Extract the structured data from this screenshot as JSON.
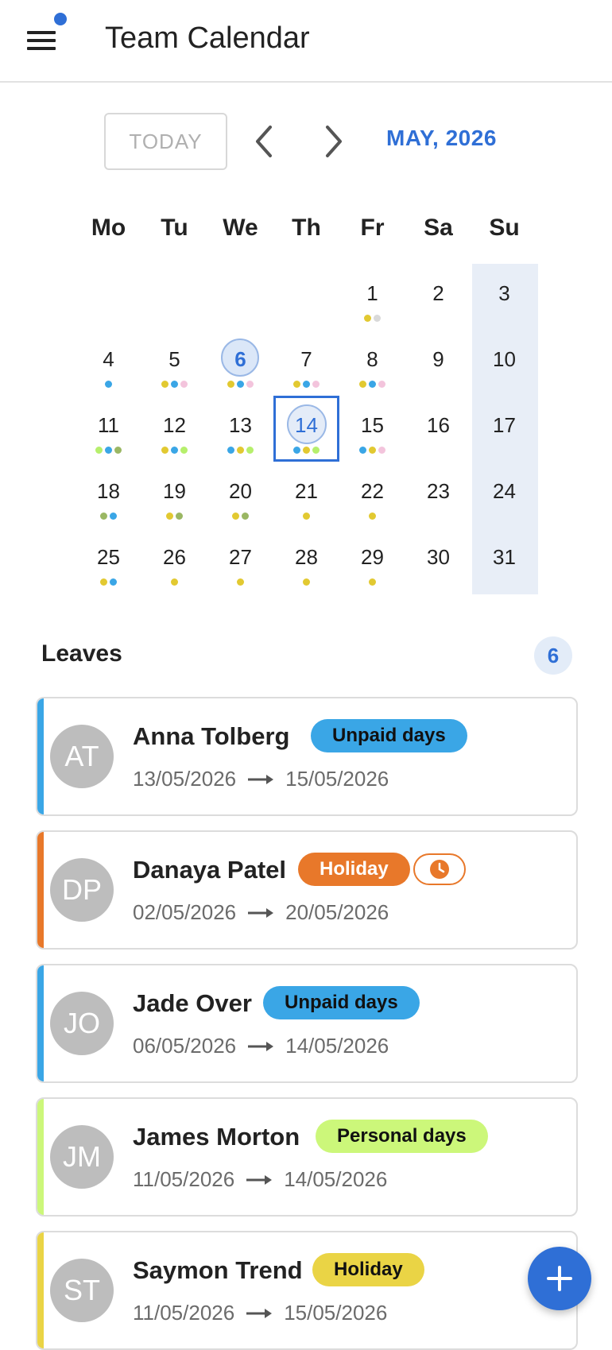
{
  "app": {
    "title": "Team Calendar"
  },
  "toolbar": {
    "today_label": "TODAY",
    "month_label": "MAY, 2026"
  },
  "colors": {
    "accent": "#2f6fd6",
    "unpaid": "#3aa6e6",
    "holiday_orange": "#e8782a",
    "personal": "#ccf77a",
    "holiday_yellow": "#ead445",
    "dot_yellow": "#e2c931",
    "dot_blue": "#3aa6e6",
    "dot_pink": "#f3c4dc",
    "dot_gray": "#d9d9d9",
    "dot_lime": "#b6ef6c",
    "dot_olive": "#9ab763"
  },
  "calendar": {
    "weekdays": [
      "Mo",
      "Tu",
      "We",
      "Th",
      "Fr",
      "Sa",
      "Su"
    ],
    "today": 6,
    "selected": 14,
    "weeks": [
      [
        null,
        null,
        null,
        null,
        {
          "d": "1",
          "dots": [
            "yellow",
            "gray"
          ]
        },
        {
          "d": "2",
          "dots": []
        },
        {
          "d": "3",
          "dots": []
        }
      ],
      [
        {
          "d": "4",
          "dots": [
            "blue"
          ]
        },
        {
          "d": "5",
          "dots": [
            "yellow",
            "blue",
            "pink"
          ]
        },
        {
          "d": "6",
          "dots": [
            "yellow",
            "blue",
            "pink"
          ]
        },
        {
          "d": "7",
          "dots": [
            "yellow",
            "blue",
            "pink"
          ]
        },
        {
          "d": "8",
          "dots": [
            "yellow",
            "blue",
            "pink"
          ]
        },
        {
          "d": "9",
          "dots": []
        },
        {
          "d": "10",
          "dots": []
        }
      ],
      [
        {
          "d": "11",
          "dots": [
            "lime",
            "blue",
            "olive"
          ]
        },
        {
          "d": "12",
          "dots": [
            "yellow",
            "blue",
            "lime"
          ]
        },
        {
          "d": "13",
          "dots": [
            "blue",
            "yellow",
            "lime"
          ]
        },
        {
          "d": "14",
          "dots": [
            "blue",
            "yellow",
            "lime"
          ]
        },
        {
          "d": "15",
          "dots": [
            "blue",
            "yellow",
            "pink"
          ]
        },
        {
          "d": "16",
          "dots": []
        },
        {
          "d": "17",
          "dots": []
        }
      ],
      [
        {
          "d": "18",
          "dots": [
            "olive",
            "blue"
          ]
        },
        {
          "d": "19",
          "dots": [
            "yellow",
            "olive"
          ]
        },
        {
          "d": "20",
          "dots": [
            "yellow",
            "olive"
          ]
        },
        {
          "d": "21",
          "dots": [
            "yellow"
          ]
        },
        {
          "d": "22",
          "dots": [
            "yellow"
          ]
        },
        {
          "d": "23",
          "dots": []
        },
        {
          "d": "24",
          "dots": []
        }
      ],
      [
        {
          "d": "25",
          "dots": [
            "yellow",
            "blue"
          ]
        },
        {
          "d": "26",
          "dots": [
            "yellow"
          ]
        },
        {
          "d": "27",
          "dots": [
            "yellow"
          ]
        },
        {
          "d": "28",
          "dots": [
            "yellow"
          ]
        },
        {
          "d": "29",
          "dots": [
            "yellow"
          ]
        },
        {
          "d": "30",
          "dots": []
        },
        {
          "d": "31",
          "dots": []
        }
      ]
    ]
  },
  "leaves": {
    "title": "Leaves",
    "count": "6",
    "items": [
      {
        "initials": "AT",
        "name": "Anna Tolberg",
        "type": "Unpaid days",
        "color": "#3aa6e6",
        "text_color": "#111111",
        "from": "13/05/2026",
        "to": "15/05/2026",
        "pending": false
      },
      {
        "initials": "DP",
        "name": "Danaya Patel",
        "type": "Holiday",
        "color": "#e8782a",
        "text_color": "#ffffff",
        "from": "02/05/2026",
        "to": "20/05/2026",
        "pending": true
      },
      {
        "initials": "JO",
        "name": "Jade Over",
        "type": "Unpaid days",
        "color": "#3aa6e6",
        "text_color": "#111111",
        "from": "06/05/2026",
        "to": "14/05/2026",
        "pending": false
      },
      {
        "initials": "JM",
        "name": "James Morton",
        "type": "Personal days",
        "color": "#ccf77a",
        "text_color": "#111111",
        "from": "11/05/2026",
        "to": "14/05/2026",
        "pending": false
      },
      {
        "initials": "ST",
        "name": "Saymon Trend",
        "type": "Holiday",
        "color": "#ead445",
        "text_color": "#111111",
        "from": "11/05/2026",
        "to": "15/05/2026",
        "pending": false
      }
    ]
  },
  "fab": {
    "icon": "plus-icon"
  }
}
